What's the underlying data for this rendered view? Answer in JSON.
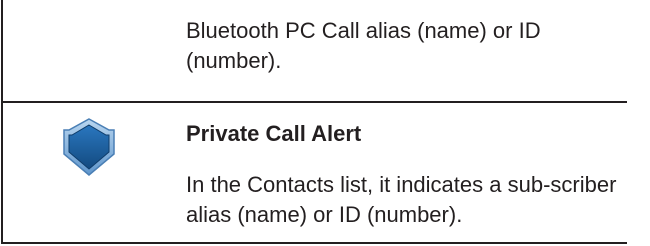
{
  "rows": [
    {
      "description": "Bluetooth PC Call alias (name) or ID (number)."
    },
    {
      "icon": "shield-icon",
      "title": "Private Call Alert",
      "description": "In the Contacts list, it indicates a sub-scriber alias (name) or ID (number)."
    }
  ],
  "colors": {
    "text": "#231f20",
    "rule": "#231f20",
    "icon_fill": "#1f5f9e",
    "icon_border": "#7fb3e0"
  }
}
